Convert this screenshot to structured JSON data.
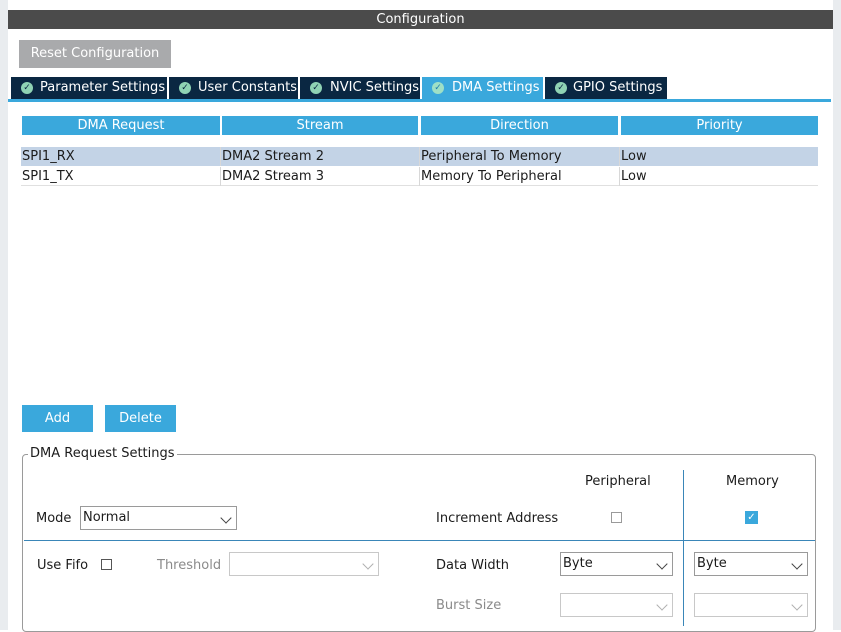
{
  "window": {
    "title": "Configuration"
  },
  "toolbar": {
    "reset_label": "Reset Configuration"
  },
  "tabs": [
    {
      "label": "Parameter Settings",
      "active": false
    },
    {
      "label": "User Constants",
      "active": false
    },
    {
      "label": "NVIC Settings",
      "active": false
    },
    {
      "label": "DMA Settings",
      "active": true
    },
    {
      "label": "GPIO Settings",
      "active": false
    }
  ],
  "table": {
    "headers": [
      "DMA Request",
      "Stream",
      "Direction",
      "Priority"
    ],
    "rows": [
      {
        "request": "SPI1_RX",
        "stream": "DMA2 Stream 2",
        "direction": "Peripheral To Memory",
        "priority": "Low",
        "selected": true
      },
      {
        "request": "SPI1_TX",
        "stream": "DMA2 Stream 3",
        "direction": "Memory To Peripheral",
        "priority": "Low",
        "selected": false
      }
    ]
  },
  "actions": {
    "add_label": "Add",
    "delete_label": "Delete"
  },
  "settings": {
    "group_title": "DMA Request Settings",
    "peripheral_header": "Peripheral",
    "memory_header": "Memory",
    "mode_label": "Mode",
    "mode_value": "Normal",
    "increment_label": "Increment Address",
    "peripheral_increment": false,
    "memory_increment": true,
    "use_fifo_label": "Use Fifo",
    "use_fifo": false,
    "threshold_label": "Threshold",
    "threshold_value": "",
    "data_width_label": "Data Width",
    "peripheral_data_width": "Byte",
    "memory_data_width": "Byte",
    "burst_size_label": "Burst Size",
    "peripheral_burst": "",
    "memory_burst": ""
  },
  "colors": {
    "accent": "#3aa8dc",
    "tab_bg": "#0a2742",
    "selected_row": "#c3d3e6",
    "title_bar": "#4b4b4b"
  },
  "icons": {
    "tab_status": "check-circle-icon",
    "dropdown": "chevron-down-icon",
    "checkbox_checked": "check-icon"
  }
}
